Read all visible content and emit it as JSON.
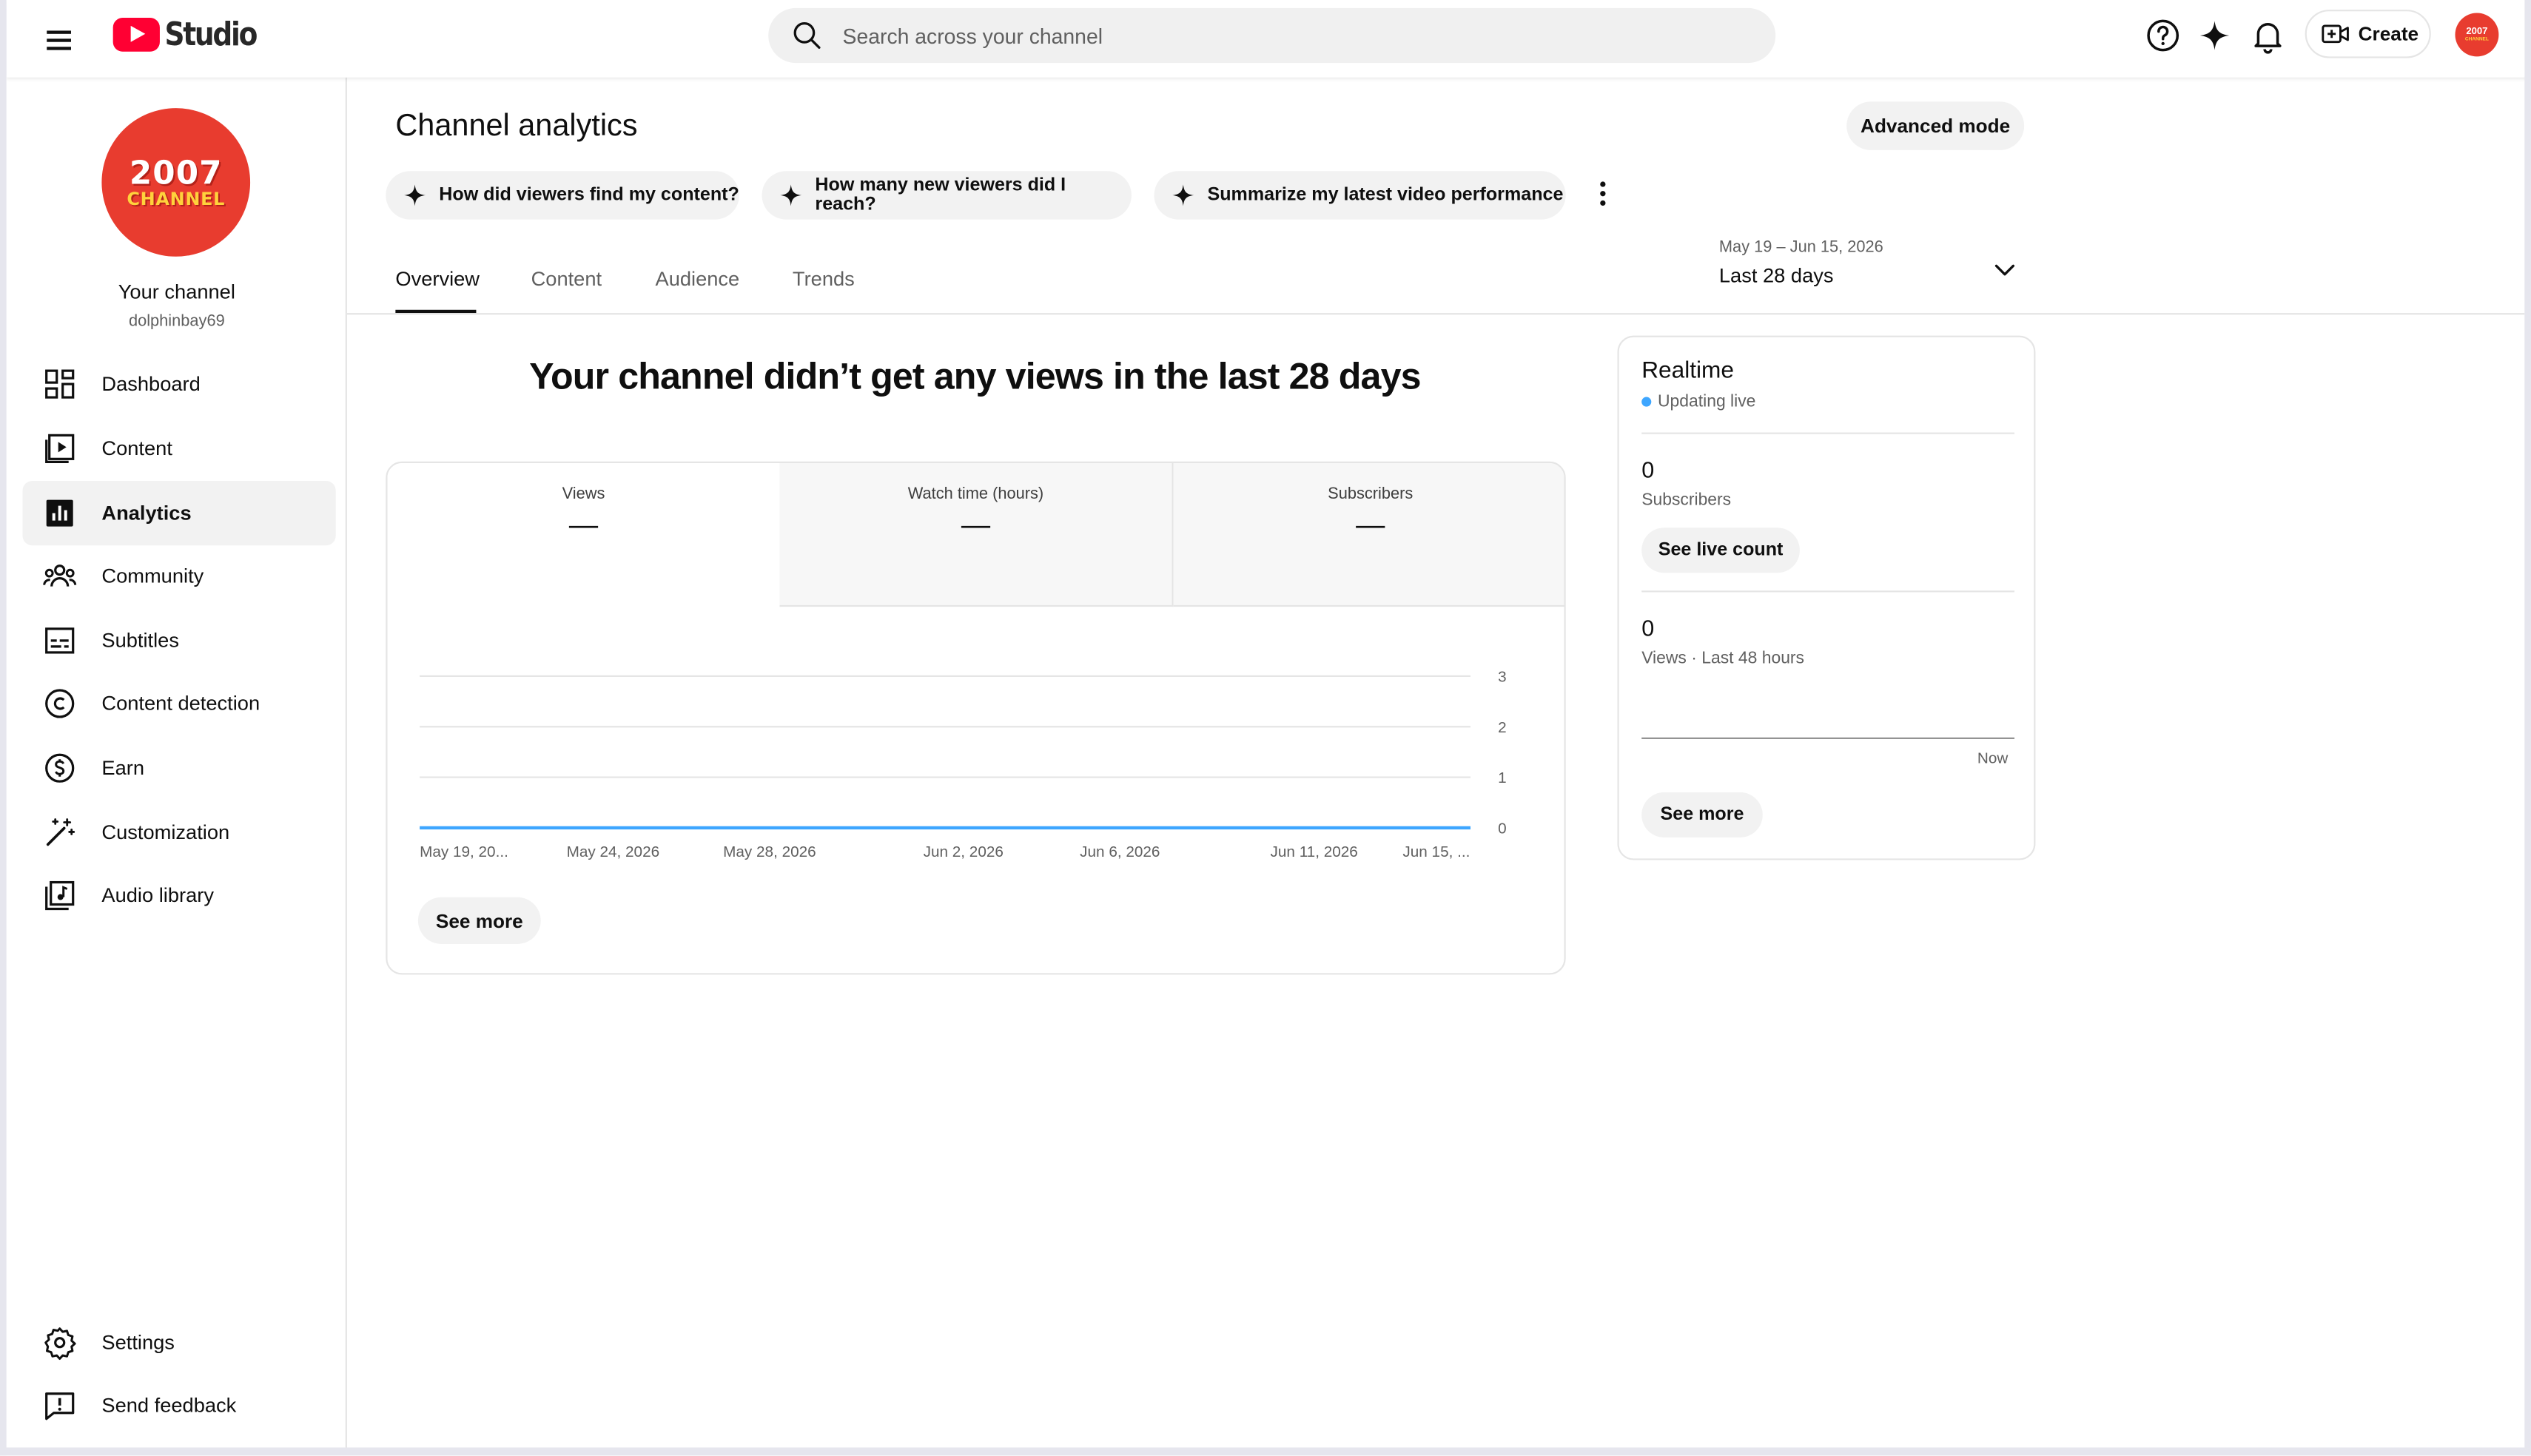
{
  "header": {
    "app_name": "Studio",
    "search_placeholder": "Search across your channel",
    "create_label": "Create",
    "avatar_text": "2007",
    "avatar_subtext": "CHANNEL"
  },
  "sidebar": {
    "channel_avatar_line1": "2007",
    "channel_avatar_line2": "CHANNEL",
    "channel_name": "Your channel",
    "channel_handle": "dolphinbay69",
    "items": [
      {
        "label": "Dashboard",
        "icon": "dashboard-icon"
      },
      {
        "label": "Content",
        "icon": "content-icon"
      },
      {
        "label": "Analytics",
        "icon": "analytics-icon",
        "active": true
      },
      {
        "label": "Community",
        "icon": "community-icon"
      },
      {
        "label": "Subtitles",
        "icon": "subtitles-icon"
      },
      {
        "label": "Content detection",
        "icon": "copyright-icon"
      },
      {
        "label": "Earn",
        "icon": "dollar-icon"
      },
      {
        "label": "Customization",
        "icon": "magic-wand-icon"
      },
      {
        "label": "Audio library",
        "icon": "audio-library-icon"
      }
    ],
    "bottom_items": [
      {
        "label": "Settings",
        "icon": "gear-icon"
      },
      {
        "label": "Send feedback",
        "icon": "feedback-icon"
      }
    ]
  },
  "main": {
    "title": "Channel analytics",
    "advanced_mode_label": "Advanced mode",
    "chips": [
      "How did viewers find my content?",
      "How many new viewers did I reach?",
      "Summarize my latest video performance"
    ],
    "tabs": [
      "Overview",
      "Content",
      "Audience",
      "Trends"
    ],
    "active_tab": "Overview",
    "date_range": {
      "dates": "May 19 – Jun 15, 2026",
      "label": "Last 28 days"
    },
    "headline": "Your channel didn’t get any views in the last 28 days",
    "metrics": [
      {
        "label": "Views",
        "value": "—"
      },
      {
        "label": "Watch time (hours)",
        "value": "—"
      },
      {
        "label": "Subscribers",
        "value": "—"
      }
    ],
    "see_more_label": "See more"
  },
  "chart_data": {
    "type": "line",
    "series": [
      {
        "values": [
          0,
          0,
          0,
          0,
          0,
          0,
          0,
          0,
          0,
          0,
          0,
          0,
          0,
          0,
          0,
          0,
          0,
          0,
          0,
          0,
          0,
          0,
          0,
          0,
          0,
          0,
          0,
          0
        ]
      }
    ],
    "x_tick_labels": [
      "May 19, 20...",
      "May 24, 2026",
      "May 28, 2026",
      "Jun 2, 2026",
      "Jun 6, 2026",
      "Jun 11, 2026",
      "Jun 15, ..."
    ],
    "y_ticks": [
      0,
      1,
      2,
      3
    ],
    "ylim": [
      0,
      3
    ],
    "grid": true,
    "line_color": "#3ea6ff"
  },
  "realtime": {
    "title": "Realtime",
    "status": "Updating live",
    "subscribers_value": "0",
    "subscribers_label": "Subscribers",
    "see_live_count_label": "See live count",
    "views_value": "0",
    "views_label": "Views · Last 48 hours",
    "now_label": "Now",
    "see_more_label": "See more"
  },
  "colors": {
    "brand_red": "#ff0033",
    "avatar_red": "#e83c2f",
    "live_dot": "#3ea6ff"
  }
}
